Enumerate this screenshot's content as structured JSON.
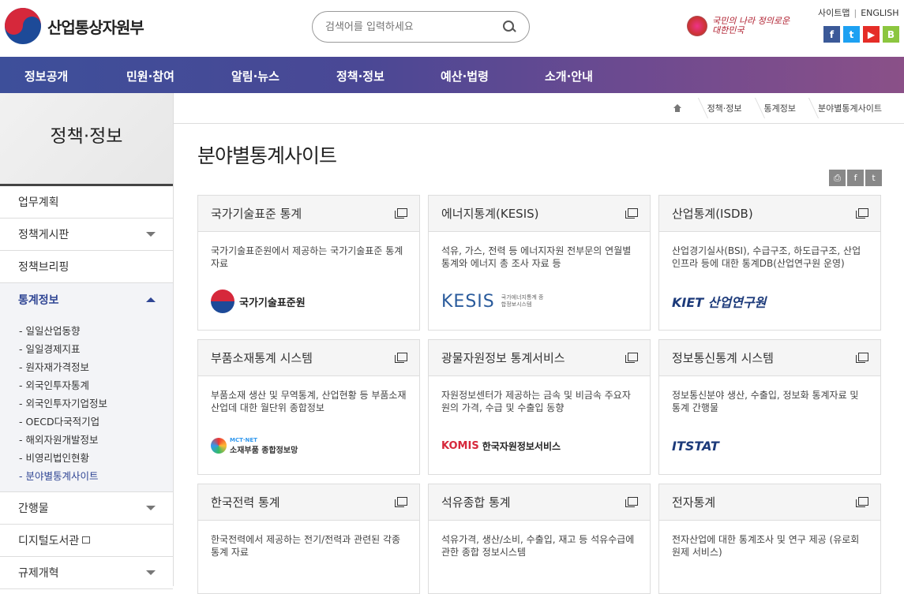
{
  "header": {
    "logo_text": "산업통상자원부",
    "search_placeholder": "검색어를 입력하세요",
    "slogan": "국민의 나라 정의로운 대한민국",
    "sitemap": "사이트맵",
    "english": "ENGLISH",
    "sns": [
      {
        "name": "facebook",
        "glyph": "f",
        "color": "#3b5998"
      },
      {
        "name": "twitter",
        "glyph": "t",
        "color": "#1da1f2"
      },
      {
        "name": "youtube",
        "glyph": "▶",
        "color": "#e52d27"
      },
      {
        "name": "blog",
        "glyph": "B",
        "color": "#8cc63f"
      }
    ]
  },
  "gnb": [
    "정보공개",
    "민원·참여",
    "알림·뉴스",
    "정책·정보",
    "예산·법령",
    "소개·안내"
  ],
  "lnb": {
    "title": "정책·정보",
    "items": [
      {
        "label": "업무계획"
      },
      {
        "label": "정책게시판"
      },
      {
        "label": "정책브리핑"
      },
      {
        "label": "통계정보"
      },
      {
        "label": "간행물"
      },
      {
        "label": "디지털도서관"
      },
      {
        "label": "규제개혁"
      }
    ],
    "sub": [
      "일일산업동향",
      "일일경제지표",
      "원자재가격정보",
      "외국인투자통계",
      "외국인투자기업정보",
      "OECD다국적기업",
      "해외자원개발정보",
      "비영리법인현황",
      "분야별통계사이트"
    ]
  },
  "breadcrumb": [
    "정책·정보",
    "통계정보",
    "분야별통계사이트"
  ],
  "page_title": "분야별통계사이트",
  "share": [
    "print",
    "facebook",
    "twitter"
  ],
  "cards": [
    {
      "title": "국가기술표준 통계",
      "desc": "국가기술표준원에서 제공하는 국가기술표준 통계자료",
      "logo": "국가기술표준원"
    },
    {
      "title": "에너지통계(KESIS)",
      "desc": "석유, 가스, 전력 등 에너지자원 전부문의 연월별 통계와 에너지 총 조사 자료 등",
      "logo": "KESIS",
      "logo_sub": "국가에너지통계 종합정보시스템"
    },
    {
      "title": "산업통계(ISDB)",
      "desc": "산업경기실사(BSI), 수급구조, 하도급구조, 산업인프라 등에 대한 통계DB(산업연구원 운영)",
      "logo": "KIET 산업연구원"
    },
    {
      "title": "부품소재통계 시스템",
      "desc": "부품소재 생산 및 무역통계, 산업현황 등 부품소재 산업데 대한 월단위 종합정보",
      "logo": "소재부품 종합정보망",
      "logo_sub": "MCT·NET"
    },
    {
      "title": "광물자원정보 통계서비스",
      "desc": "자원정보센터가 제공하는 금속 및 비금속 주요자원의 가격, 수급 및 수출입 동향",
      "logo": "KOMIS",
      "logo_sub": "한국자원정보서비스"
    },
    {
      "title": "정보통신통계 시스템",
      "desc": "정보통신분야 생산, 수출입, 정보화 통계자료 및 통계 간행물",
      "logo": "ITSTAT"
    },
    {
      "title": "한국전력 통계",
      "desc": "한국전력에서 제공하는 전기/전력과 관련된 각종 통계 자료",
      "logo": ""
    },
    {
      "title": "석유종합 통계",
      "desc": "석유가격, 생산/소비, 수출입, 재고 등 석유수급에 관한 종합 정보시스템",
      "logo": ""
    },
    {
      "title": "전자통계",
      "desc": "전자산업에 대한 통계조사 및 연구 제공 (유로회원제 서비스)",
      "logo": ""
    }
  ]
}
